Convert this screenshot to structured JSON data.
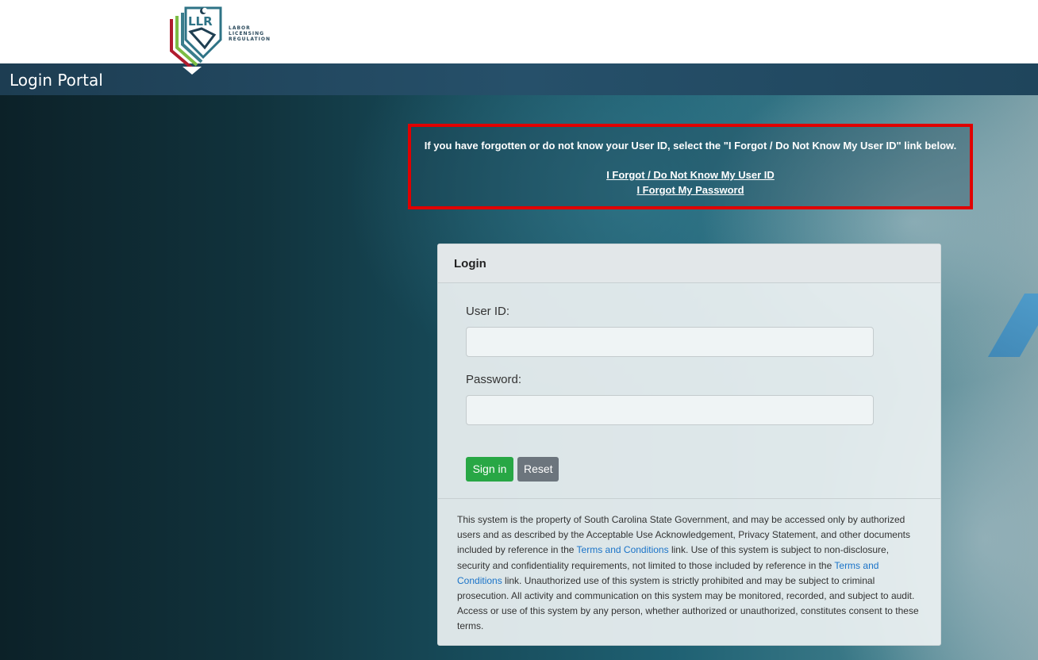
{
  "header": {
    "logo_initials": "LLR",
    "logo_lines": [
      "LABOR",
      "LICENSING",
      "REGULATION"
    ],
    "portal_title": "Login Portal"
  },
  "notice": {
    "message": "If you have forgotten or do not know your User ID, select the \"I Forgot / Do Not Know My User ID\" link below.",
    "forgot_userid_link": "I Forgot / Do Not Know My User ID",
    "forgot_password_link": "I Forgot My Password",
    "highlight_color": "#e00000"
  },
  "login": {
    "title": "Login",
    "userid_label": "User ID:",
    "userid_value": "",
    "password_label": "Password:",
    "password_value": "",
    "signin_label": "Sign in",
    "reset_label": "Reset",
    "signin_color": "#28a745",
    "reset_color": "#6c757d"
  },
  "disclaimer": {
    "part1": "This system is the property of South Carolina State Government, and may be accessed only by authorized users and as described by the Acceptable Use Acknowledgement, Privacy Statement, and other documents included by reference in the ",
    "link1": "Terms and Conditions",
    "part2": " link. Use of this system is subject to non-disclosure, security and confidentiality requirements, not limited to those included by reference in the ",
    "link2": "Terms and Conditions",
    "part3": " link. Unauthorized use of this system is strictly prohibited and may be subject to criminal prosecution. All activity and communication on this system may be monitored, recorded, and subject to audit. Access or use of this system by any person, whether authorized or unauthorized, constitutes consent to these terms.",
    "link_color": "#1a73c8"
  }
}
